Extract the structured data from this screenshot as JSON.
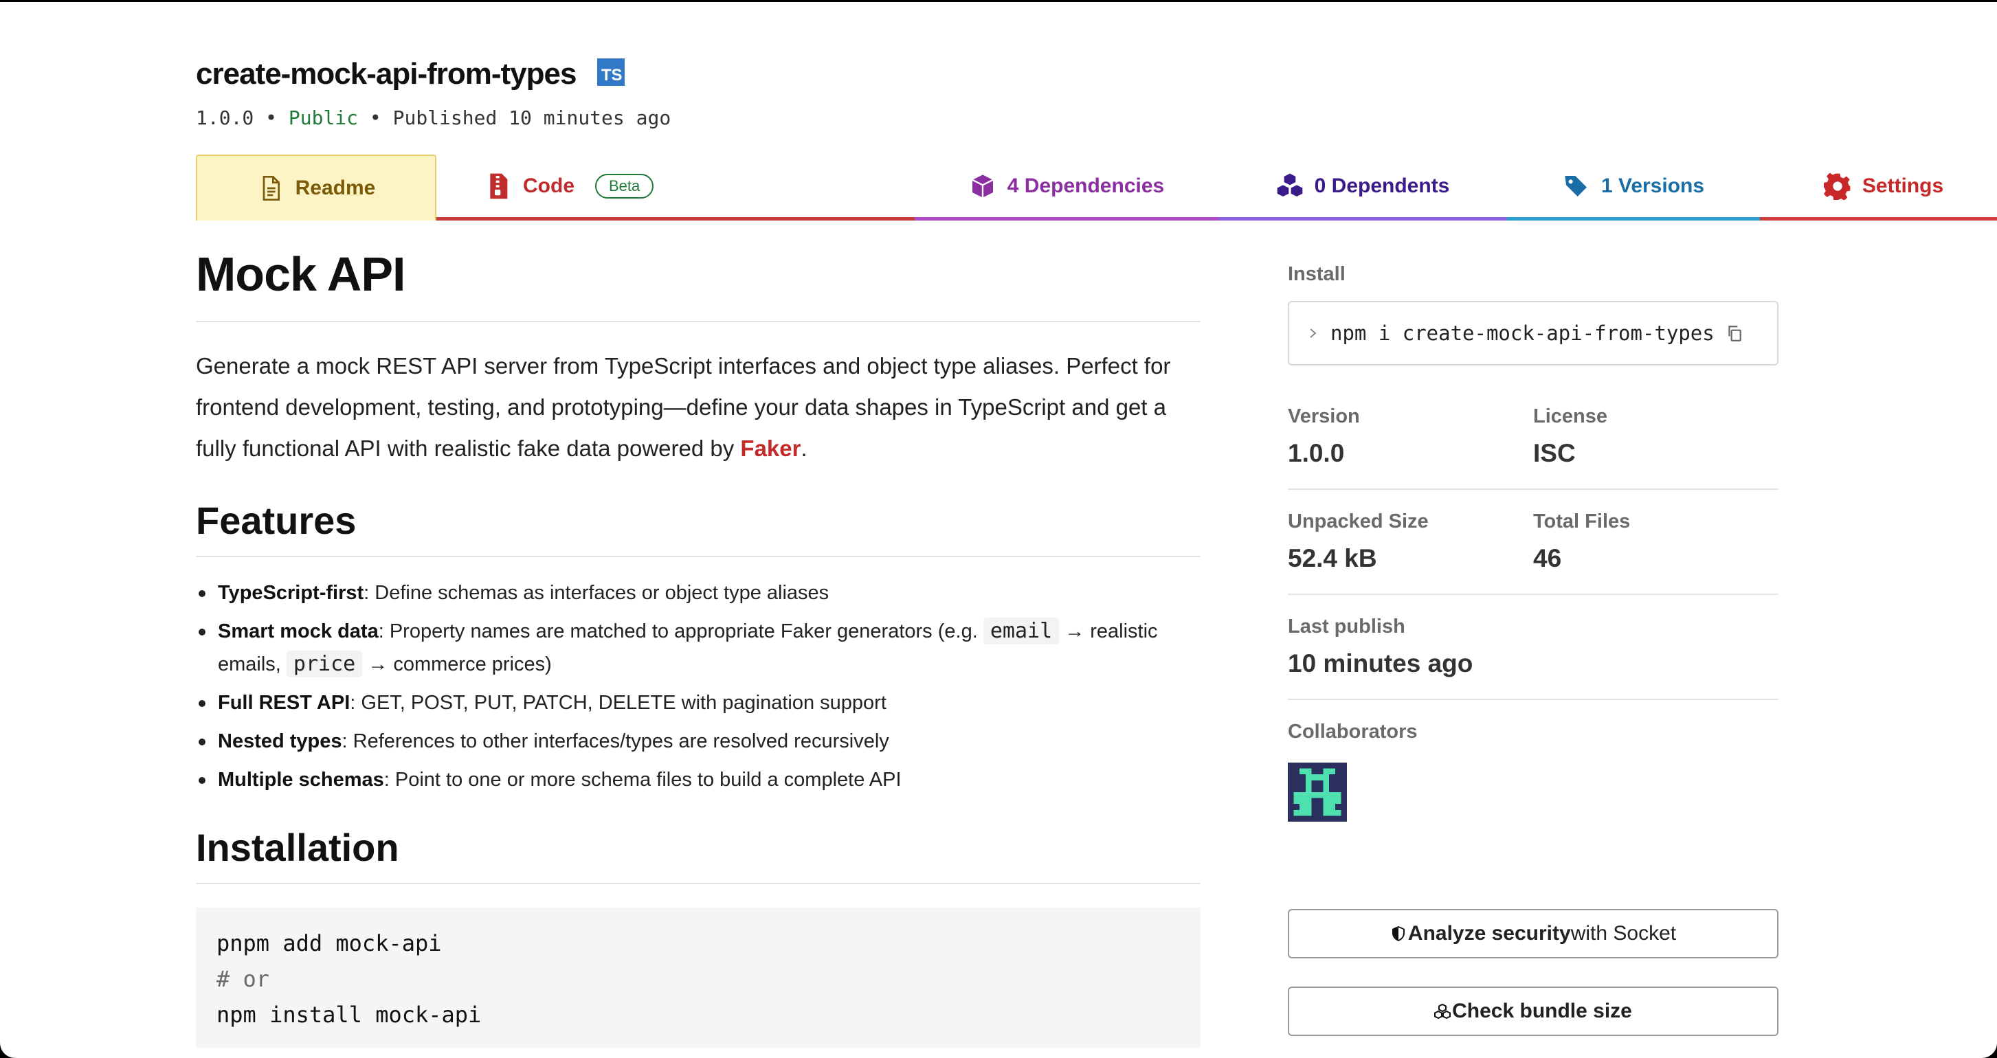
{
  "package": {
    "name": "create-mock-api-from-types",
    "ts_badge": "TS",
    "version": "1.0.0",
    "sep": "•",
    "visibility": "Public",
    "published": "Published 10 minutes ago"
  },
  "tabs": {
    "readme": "Readme",
    "code": "Code",
    "beta": "Beta",
    "dependencies": "4 Dependencies",
    "dependents": "0 Dependents",
    "versions": "1 Versions",
    "settings": "Settings"
  },
  "readme": {
    "title": "Mock API",
    "intro_before": "Generate a mock REST API server from TypeScript interfaces and object type aliases. Perfect for frontend development, testing, and prototyping—define your data shapes in TypeScript and get a fully functional API with realistic fake data powered by ",
    "intro_link": "Faker",
    "intro_after": ".",
    "features_title": "Features",
    "features": [
      {
        "bold": "TypeScript-first",
        "text": ": Define schemas as interfaces or object type aliases"
      },
      {
        "bold": "Smart mock data",
        "text_a": ": Property names are matched to appropriate Faker generators (e.g. ",
        "code_a": "email",
        "text_b": " → realistic emails, ",
        "code_b": "price",
        "text_c": " → commerce prices)"
      },
      {
        "bold": "Full REST API",
        "text": ": GET, POST, PUT, PATCH, DELETE with pagination support"
      },
      {
        "bold": "Nested types",
        "text": ": References to other interfaces/types are resolved recursively"
      },
      {
        "bold": "Multiple schemas",
        "text": ": Point to one or more schema files to build a complete API"
      }
    ],
    "installation_title": "Installation",
    "code_lines": [
      "pnpm add mock-api",
      "# or",
      "npm install mock-api"
    ]
  },
  "sidebar": {
    "install_label": "Install",
    "install_command": "npm i create-mock-api-from-types",
    "version_label": "Version",
    "version_value": "1.0.0",
    "license_label": "License",
    "license_value": "ISC",
    "unpacked_label": "Unpacked Size",
    "unpacked_value": "52.4 kB",
    "files_label": "Total Files",
    "files_value": "46",
    "last_publish_label": "Last publish",
    "last_publish_value": "10 minutes ago",
    "collaborators_label": "Collaborators",
    "security_bold": "Analyze security",
    "security_rest": " with Socket",
    "bundle_label": "Check bundle size"
  }
}
